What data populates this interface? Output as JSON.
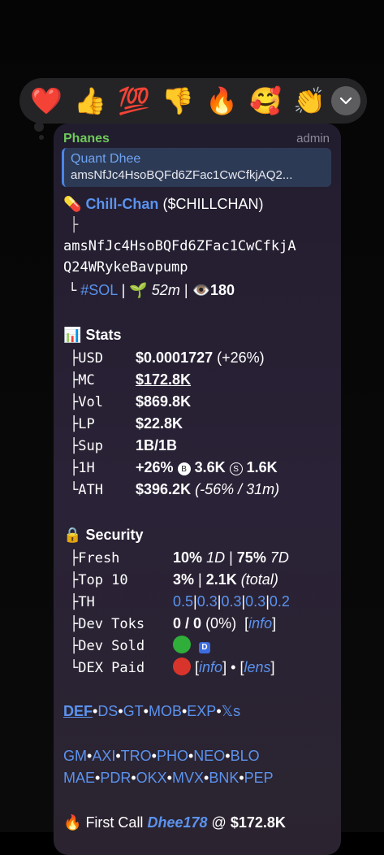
{
  "reactions": {
    "emojis": [
      "❤️",
      "👍",
      "💯",
      "👎",
      "🔥",
      "🥰",
      "👏"
    ],
    "more_icon": "chevron-down-icon"
  },
  "message": {
    "sender": "Phanes",
    "role": "admin",
    "reply": {
      "name": "Quant Dhee",
      "text": "amsNfJc4HsoBQFd6ZFac1CwCfkjAQ2..."
    },
    "token": {
      "emoji": "💊",
      "name": "Chill-Chan",
      "ticker": "($CHILLCHAN)",
      "branch": "├",
      "address_line1": "amsNfJc4HsoBQFd6ZFac1CwCfkjA",
      "address_line2": "Q24WRykeBavpump",
      "chain_prefix": "└",
      "chain": "#SOL",
      "sep": "|",
      "age_emoji": "🌱",
      "age": "52m",
      "views_emoji": "👁️",
      "views": "180"
    },
    "stats": {
      "emoji": "📊",
      "title": "Stats",
      "rows": [
        {
          "label": "├USD",
          "value": "$0.0001727",
          "extra": "(+26%)"
        },
        {
          "label": "├MC",
          "value": "$172.8K"
        },
        {
          "label": "├Vol",
          "value": "$869.8K"
        },
        {
          "label": "├LP",
          "value": "$22.8K"
        },
        {
          "label": "├Sup",
          "value": "1B/1B"
        },
        {
          "label": "├1H",
          "value": "+26%",
          "buys": "3.6K",
          "sells": "1.6K"
        },
        {
          "label": "└ATH",
          "value": "$396.2K",
          "extra": "(-56% / 31m)"
        }
      ],
      "buy_glyph": "B",
      "sell_glyph": "S"
    },
    "security": {
      "emoji": "🔒",
      "title": "Security",
      "fresh": {
        "label": "├Fresh",
        "v1": "10%",
        "v1_period": "1D",
        "sep": "|",
        "v2": "75%",
        "v2_period": "7D"
      },
      "top10": {
        "label": "├Top 10",
        "v1": "3%",
        "sep": "|",
        "v2": "2.1K",
        "v2_note": "(total)"
      },
      "th": {
        "label": "├TH",
        "values": [
          "0.5",
          "0.3",
          "0.3",
          "0.3",
          "0.2"
        ],
        "sep": "|"
      },
      "dev_toks": {
        "label": "├Dev Toks",
        "value": "0 / 0",
        "pct": "(0%)",
        "link_open": "[",
        "link": "info",
        "link_close": "]"
      },
      "dev_sold": {
        "label": "├Dev Sold",
        "status_color": "#2fae3a",
        "badge": "D"
      },
      "dex_paid": {
        "label": "└DEX Paid",
        "status_color": "#d9342b",
        "open1": "[",
        "link1": "info",
        "close1": "]",
        "dot": "•",
        "open2": "[",
        "link2": "lens",
        "close2": "]"
      }
    },
    "links_row1": {
      "items": [
        "DEF",
        "DS",
        "GT",
        "MOB",
        "EXP",
        "𝕏s"
      ],
      "sep": "•"
    },
    "links_row2": {
      "items": [
        "GM",
        "AXI",
        "TRO",
        "PHO",
        "NEO",
        "BLO"
      ],
      "sep": "•"
    },
    "links_row3": {
      "items": [
        "MAE",
        "PDR",
        "OKX",
        "MVX",
        "BNK",
        "PEP"
      ],
      "sep": "•"
    },
    "first_call": {
      "emoji": "🔥",
      "label": "First Call",
      "user": "Dhee178",
      "at": "@",
      "value": "$172.8K"
    }
  }
}
